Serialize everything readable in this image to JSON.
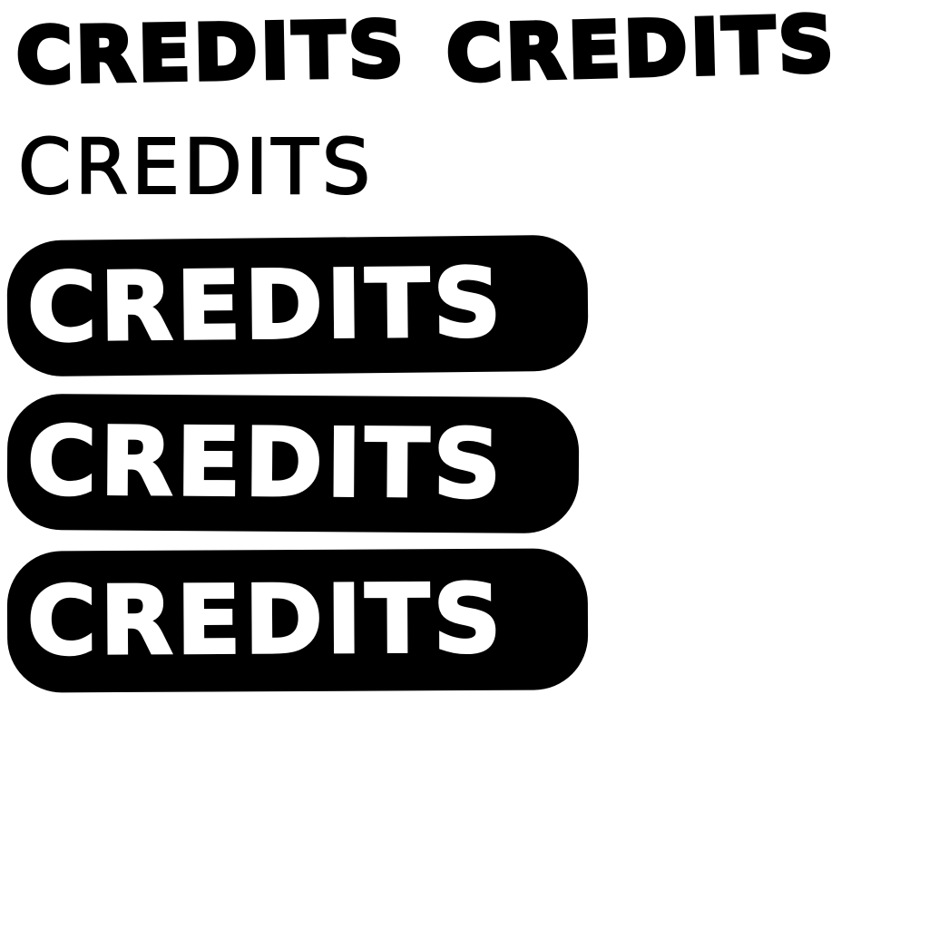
{
  "sprites": {
    "outlined_bold_1": "CREDITS",
    "outlined_bold_2": "CREDITS",
    "outlined_thin": "CREDITS",
    "button_1": "CREDITS",
    "button_2": "CREDITS",
    "button_3": "CREDITS"
  },
  "colors": {
    "ink": "#000000",
    "background": "#ffffff",
    "button_text": "#ffffff"
  }
}
